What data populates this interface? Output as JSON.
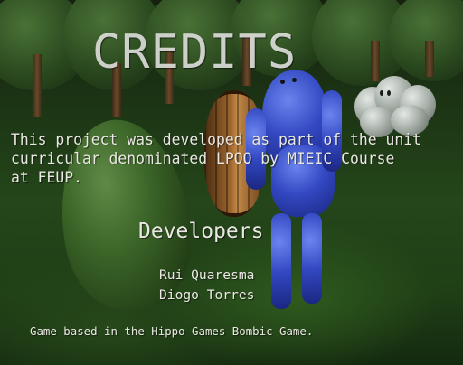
{
  "credits": {
    "title": "CREDITS",
    "description_lines": [
      "This project was developed as part of the unit",
      "curricular denominated LPOO by MIEIC Course",
      "at FEUP."
    ],
    "developers_heading": "Developers",
    "developers": [
      "Rui Quaresma",
      "Diogo Torres"
    ],
    "footer": "Game based in the Hippo Games Bombic Game."
  },
  "colors": {
    "text": "#eae8e2",
    "grass": "#24461a",
    "character": "#3348c2"
  }
}
